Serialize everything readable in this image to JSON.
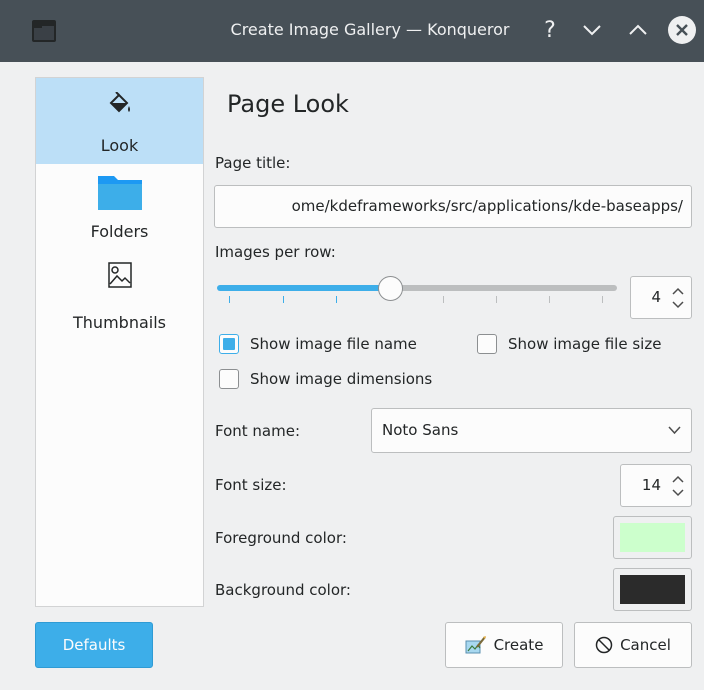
{
  "window": {
    "title": "Create Image Gallery — Konqueror",
    "help_glyph": "?",
    "min_glyph": "⌄",
    "max_glyph": "⌃",
    "close_glyph": "✕"
  },
  "sidebar": {
    "items": [
      {
        "label": "Look",
        "icon": "paint-bucket-icon",
        "active": true
      },
      {
        "label": "Folders",
        "icon": "folder-icon",
        "active": false
      },
      {
        "label": "Thumbnails",
        "icon": "image-icon",
        "active": false
      }
    ]
  },
  "page": {
    "heading": "Page Look",
    "page_title_label": "Page title:",
    "page_title_value": "ome/kdeframeworks/src/applications/kde-baseapps/",
    "images_per_row_label": "Images per row:",
    "images_per_row_value": "4",
    "show_file_name": {
      "label": "Show image file name",
      "checked": true
    },
    "show_file_size": {
      "label": "Show image file size",
      "checked": false
    },
    "show_dimensions": {
      "label": "Show image dimensions",
      "checked": false
    },
    "font_name_label": "Font name:",
    "font_name_value": "Noto Sans",
    "font_size_label": "Font size:",
    "font_size_value": "14",
    "foreground_label": "Foreground color:",
    "foreground_color": "#ccffcc",
    "background_label": "Background color:",
    "background_color": "#2b2b2b"
  },
  "buttons": {
    "defaults": "Defaults",
    "create": "Create",
    "cancel": "Cancel"
  },
  "colors": {
    "accent": "#3daee9",
    "titlebar": "#475057",
    "window_bg": "#eff0f1"
  }
}
